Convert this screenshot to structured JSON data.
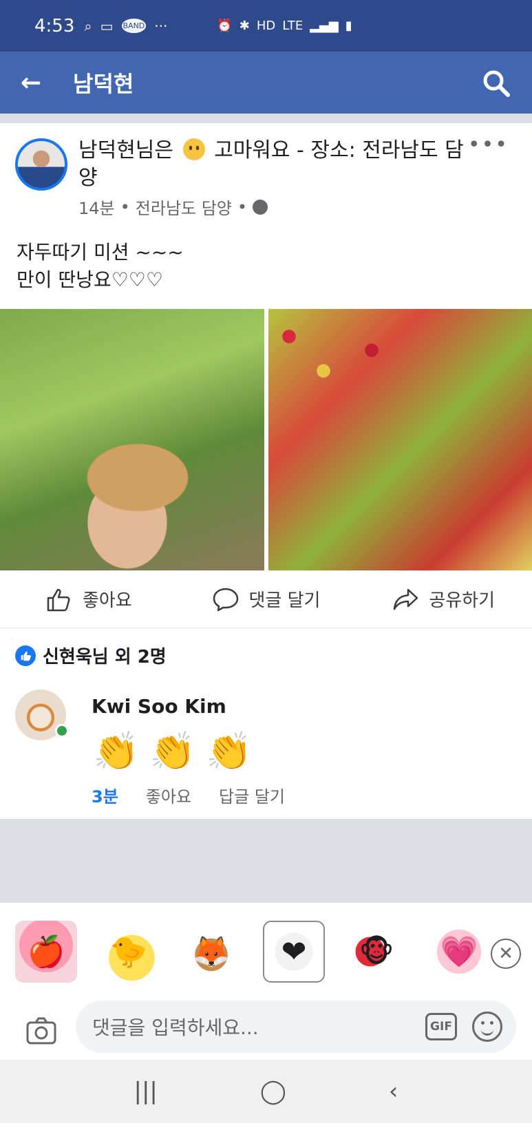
{
  "status_bar": {
    "time": "4:53",
    "icons": [
      "search-icon",
      "voicemail-icon",
      "band-app-icon",
      "more-icon",
      "alarm-icon",
      "bluetooth-icon",
      "hd-voice-icon",
      "lte-icon",
      "signal-icon",
      "battery-icon"
    ],
    "band_label": "BAND",
    "hd_label": "HD",
    "lte_label": "LTE"
  },
  "app_bar": {
    "title": "남덕현"
  },
  "post": {
    "header": "남덕현님은 😀 고마워요 - 장소: 전라남도 담양",
    "header_prefix": "남덕현님은",
    "header_suffix": "고마워요 - 장소: 전라남도 담양",
    "time": "14분",
    "location": "전라남도 담양",
    "separator": "•",
    "body": "자두따기 미션  ~~~\n만이 딴낭요♡♡♡",
    "more": "•••"
  },
  "actions": {
    "like": "좋아요",
    "comment": "댓글 달기",
    "share": "공유하기"
  },
  "reactions": {
    "summary": "신현욱님 외 2명"
  },
  "comment": {
    "author": "Kwi Soo Kim",
    "claps": [
      "👏",
      "👏",
      "👏"
    ],
    "time": "3분",
    "like": "좋아요",
    "reply": "답글 달기"
  },
  "composer": {
    "placeholder": "댓글을 입력하세요...",
    "gif": "GIF",
    "close": "✕"
  },
  "stickers": [
    {
      "name": "love-fruit-basket-sticker",
      "glyph": "🍎"
    },
    {
      "name": "thank-you-chick-sticker",
      "glyph": "🐤"
    },
    {
      "name": "dancing-animals-sticker",
      "glyph": "🦊"
    },
    {
      "name": "cats-heart-sticker",
      "glyph": "❤"
    },
    {
      "name": "monkey-heart-sticker",
      "glyph": "🐵"
    },
    {
      "name": "pink-heart-sticker",
      "glyph": "💗"
    }
  ],
  "navbar": {
    "recents": "|||",
    "home": "◯",
    "back": "‹"
  }
}
